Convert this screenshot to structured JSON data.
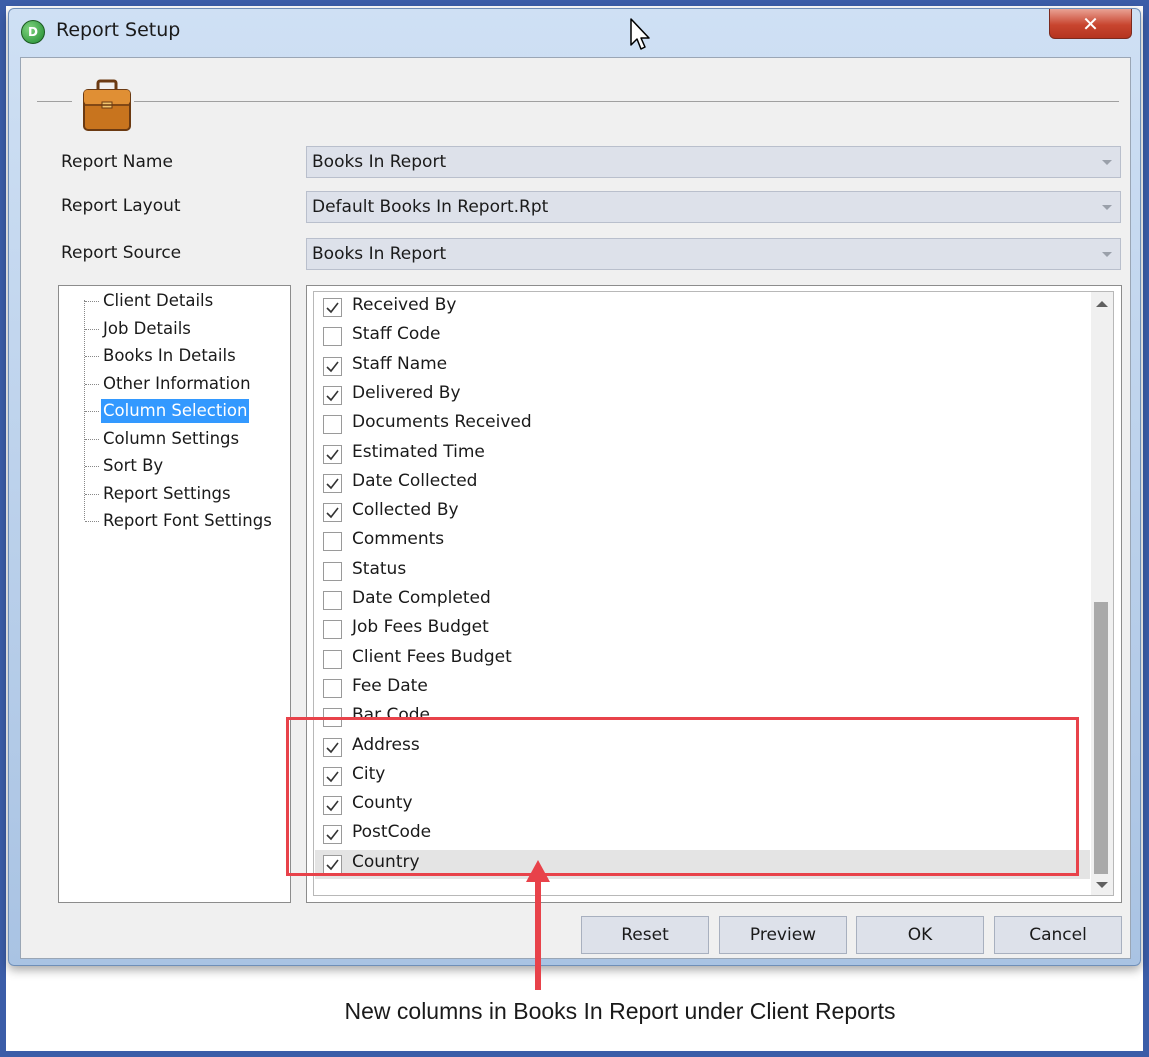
{
  "window": {
    "title": "Report Setup",
    "app_icon_letter": "D",
    "close_label": "✕"
  },
  "fields": {
    "report_name": {
      "label": "Report Name",
      "value": "Books In Report"
    },
    "report_layout": {
      "label": "Report Layout",
      "value": "Default Books In Report.Rpt"
    },
    "report_source": {
      "label": "Report Source",
      "value": "Books In Report"
    }
  },
  "tree": {
    "items": [
      {
        "label": "Client Details"
      },
      {
        "label": "Job Details"
      },
      {
        "label": "Books In Details"
      },
      {
        "label": "Other Information"
      },
      {
        "label": "Column Selection",
        "selected": true
      },
      {
        "label": "Column Settings"
      },
      {
        "label": "Sort By"
      },
      {
        "label": "Report Settings"
      },
      {
        "label": "Report Font Settings"
      }
    ]
  },
  "columns": [
    {
      "label": "Received By",
      "checked": true
    },
    {
      "label": "Staff Code",
      "checked": false
    },
    {
      "label": "Staff Name",
      "checked": true
    },
    {
      "label": "Delivered By",
      "checked": true
    },
    {
      "label": "Documents Received",
      "checked": false
    },
    {
      "label": "Estimated Time",
      "checked": true
    },
    {
      "label": "Date Collected",
      "checked": true
    },
    {
      "label": "Collected By",
      "checked": true
    },
    {
      "label": "Comments",
      "checked": false
    },
    {
      "label": "Status",
      "checked": false
    },
    {
      "label": "Date Completed",
      "checked": false
    },
    {
      "label": "Job Fees Budget",
      "checked": false
    },
    {
      "label": "Client Fees Budget",
      "checked": false
    },
    {
      "label": "Fee Date",
      "checked": false
    },
    {
      "label": "Bar Code",
      "checked": false
    },
    {
      "label": "Address",
      "checked": true
    },
    {
      "label": "City",
      "checked": true
    },
    {
      "label": "County",
      "checked": true
    },
    {
      "label": "PostCode",
      "checked": true
    },
    {
      "label": "Country",
      "checked": true,
      "highlighted": true
    }
  ],
  "buttons": {
    "reset": "Reset",
    "preview": "Preview",
    "ok": "OK",
    "cancel": "Cancel"
  },
  "caption": "New columns in Books In Report under Client Reports",
  "colors": {
    "frame_border": "#3b5da8",
    "selection": "#3399ff",
    "annotation": "#e8424a"
  }
}
